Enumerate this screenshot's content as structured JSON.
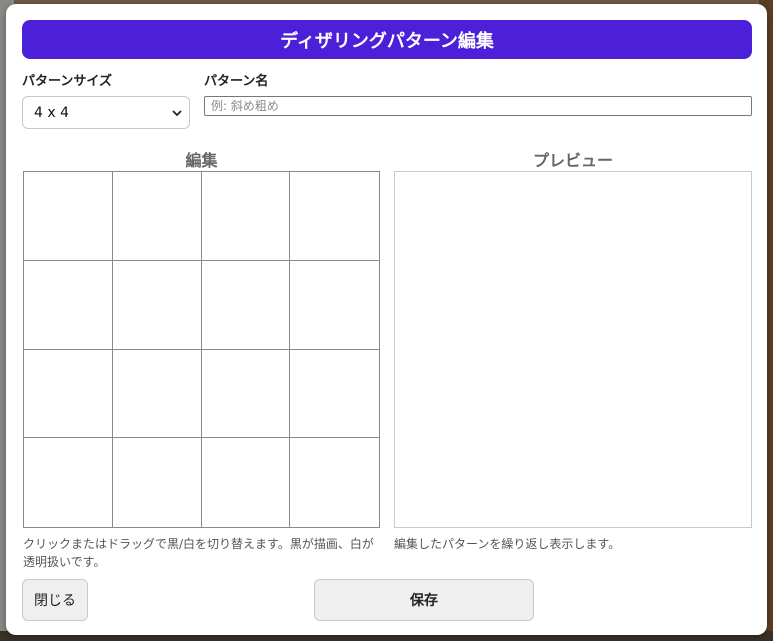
{
  "dialog": {
    "title": "ディザリングパターン編集",
    "accent_color": "#4c1fd8"
  },
  "size_field": {
    "label": "パターンサイズ",
    "selected": "4 x 4"
  },
  "name_field": {
    "label": "パターン名",
    "value": "",
    "placeholder": "例: 斜め粗め"
  },
  "editor": {
    "title": "編集",
    "rows": 4,
    "cols": 4,
    "help": "クリックまたはドラッグで黒/白を切り替えます。黒が描画、白が透明扱いです。"
  },
  "preview": {
    "title": "プレビュー",
    "help": "編集したパターンを繰り返し表示します。"
  },
  "buttons": {
    "close_label": "閉じる",
    "save_label": "保存"
  }
}
